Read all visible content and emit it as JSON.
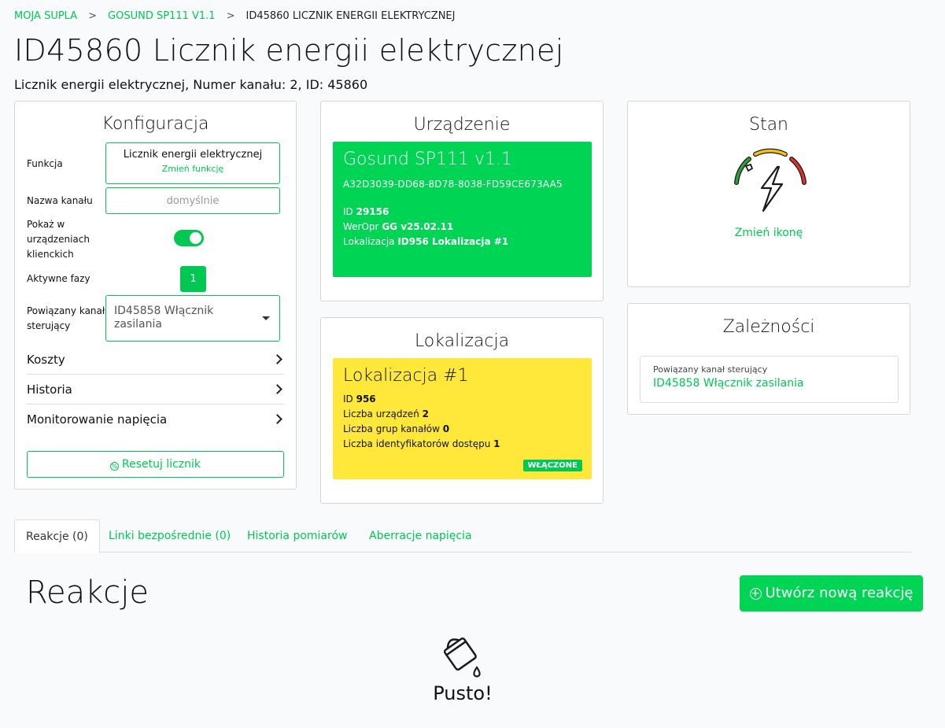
{
  "breadcrumb": {
    "home": "MOJA SUPLA",
    "device": "GOSUND SP111 V1.1",
    "current": "ID45860 LICZNIK ENERGII ELEKTRYCZNEJ",
    "sep": ">"
  },
  "page": {
    "title": "ID45860 Licznik energii elektrycznej",
    "subtitle": "Licznik energii elektrycznej, Numer kanału: 2, ID: 45860"
  },
  "config": {
    "title": "Konfiguracja",
    "function_label": "Funkcja",
    "function_value": "Licznik energii elektrycznej",
    "function_change": "Zmień funkcję",
    "channel_name_label": "Nazwa kanału",
    "channel_name_placeholder": "domyślnie",
    "show_on_clients_label": "Pokaż w urządzeniach klienckich",
    "show_on_clients": true,
    "active_phases_label": "Aktywne fazy",
    "active_phases_value": "1",
    "related_channel_label": "Powiązany kanał sterujący",
    "related_channel_value": "ID45858 Włącznik zasilania",
    "accordion": [
      "Koszty",
      "Historia",
      "Monitorowanie napięcia"
    ],
    "reset_button": "Resetuj licznik"
  },
  "device": {
    "title": "Urządzenie",
    "name": "Gosund SP111 v1.1",
    "guid": "A32D3039-DD68-8D78-8038-FD59CE673AA5",
    "id_label": "ID",
    "id_value": "29156",
    "firmware_label": "WerOpr",
    "firmware_value": "GG v25.02.11",
    "location_label": "Lokalizacja",
    "location_value": "ID956 Lokalizacja #1",
    "bg_color": "#00d454"
  },
  "location": {
    "title": "Lokalizacja",
    "name": "Lokalizacja #1",
    "id_label": "ID",
    "id_value": "956",
    "devices_label": "Liczba urządzeń",
    "devices_value": "2",
    "groups_label": "Liczba grup kanałów",
    "groups_value": "0",
    "access_ids_label": "Liczba identyfikatorów dostępu",
    "access_ids_value": "1",
    "status_badge": "WŁĄCZONE",
    "bg_color": "#ffe83a"
  },
  "state": {
    "title": "Stan",
    "icon": "electricity-meter-gauge-icon",
    "change_icon": "Zmień ikonę"
  },
  "dependencies": {
    "title": "Zależności",
    "label": "Powiązany kanał sterujący",
    "link": "ID45858 Włącznik zasilania"
  },
  "tabs": [
    "Reakcje (0)",
    "Linki bezpośrednie (0)",
    "Historia pomiarów",
    "Aberracje napięcia"
  ],
  "reactions": {
    "title": "Reakcje",
    "create_button": "Utwórz nową reakcję",
    "empty_text": "Pusto!"
  },
  "colors": {
    "accent": "#00c853"
  }
}
